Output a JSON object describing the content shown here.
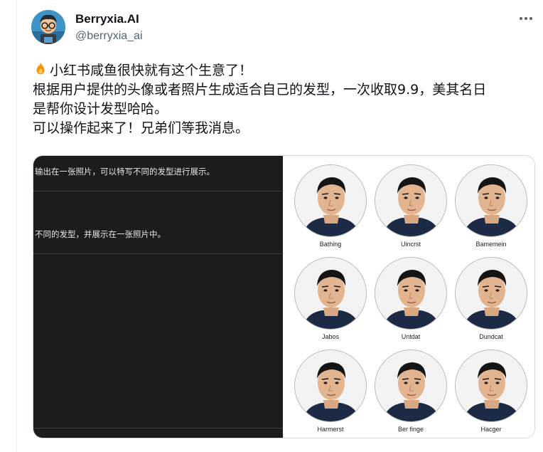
{
  "author": {
    "display_name": "Berryxia.AI",
    "handle": "@berryxia_ai"
  },
  "tweet": {
    "lines": [
      "小红书咸鱼很快就有这个生意了！",
      "根据用户提供的头像或者照片生成适合自己的发型，一次收取9.9，美其名日",
      "是帮你设计发型哈哈。",
      "可以操作起来了！兄弟们等我消息。"
    ]
  },
  "media": {
    "left_panel": {
      "text_1": "输出在一张照片，可以特写不同的发型进行展示。",
      "text_2": "不同的发型，并展示在一张照片中。"
    },
    "portraits": [
      {
        "label": "Bathing"
      },
      {
        "label": "Uincrst"
      },
      {
        "label": "Bamemein"
      },
      {
        "label": "Jabos"
      },
      {
        "label": "Untdat"
      },
      {
        "label": "Dundcat"
      },
      {
        "label": "Harmerst"
      },
      {
        "label": "Ber finge"
      },
      {
        "label": "Hacger"
      }
    ]
  },
  "colors": {
    "text_primary": "#0f1419",
    "text_secondary": "#536471",
    "dark_panel": "#1c1c1e",
    "avatar_bg": "#3f93c9"
  },
  "icons": {
    "more": "more-horizontal-icon",
    "emoji": "fire-emoji"
  }
}
